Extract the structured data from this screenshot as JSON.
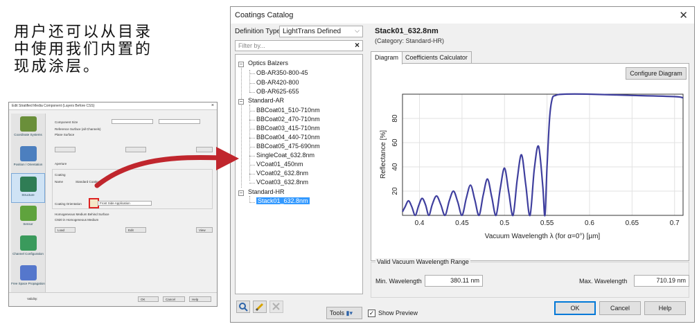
{
  "caption": {
    "line1": "用户还可以从目录",
    "line2": "中使用我们内置的",
    "line3": "现成涂层。"
  },
  "thumbnail": {
    "title": "Edit Stratified Media Component (Layers Before CSS)",
    "sidebar": [
      "Coordinate Systems",
      "Position / Orientation",
      "Structure",
      "Sensor",
      "Channel Configuration",
      "Free Space Propagation"
    ],
    "component_size_label": "Component Size",
    "reference_surface_label": "Reference Surface (all Channels)",
    "plane_surface_label": "Plane Surface",
    "aperture_label": "Aperture",
    "coating_label": "Coating",
    "name_label": "Name",
    "name_value": "Standard Coating",
    "coating_orientation_label": "Coating Orientation",
    "coating_orientation_value": "Front Side Application",
    "medium_label": "Homogeneous Medium Behind Surface",
    "medium_value": "C920 in Homogeneous Medium",
    "load_label": "Load",
    "edit_label": "Edit",
    "view_label": "View",
    "validity_label": "Validity:",
    "ok": "OK",
    "cancel": "Cancel",
    "help": "Help"
  },
  "dialog": {
    "title": "Coatings Catalog",
    "definition_type_label": "Definition Type",
    "definition_type_value": "LightTrans Defined",
    "filter_placeholder": "Filter by...",
    "tree": {
      "groups": [
        {
          "label": "Optics Balzers",
          "items": [
            "OB-AR350-800-45",
            "OB-AR420-800",
            "OB-AR625-655"
          ]
        },
        {
          "label": "Standard-AR",
          "items": [
            "BBCoat01_510-710nm",
            "BBCoat02_470-710nm",
            "BBCoat03_415-710nm",
            "BBCoat04_440-710nm",
            "BBCoat05_475-690nm",
            "SingleCoat_632.8nm",
            "VCoat01_450nm",
            "VCoat02_632.8nm",
            "VCoat03_632.8nm"
          ]
        },
        {
          "label": "Standard-HR",
          "items": [
            "Stack01_632.8nm"
          ]
        }
      ],
      "selected": "Stack01_632.8nm"
    },
    "tools_label": "Tools",
    "show_preview_label": "Show Preview",
    "selected_title": "Stack01_632.8nm",
    "selected_category": "(Category: Standard-HR)",
    "tabs": [
      "Diagram",
      "Coefficients Calculator"
    ],
    "configure_diagram_label": "Configure Diagram",
    "range_group_label": "Valid Vacuum Wavelength Range",
    "min_wavelength_label": "Min. Wavelength",
    "min_wavelength_value": "380.11 nm",
    "max_wavelength_label": "Max. Wavelength",
    "max_wavelength_value": "710.19 nm",
    "ok": "OK",
    "cancel": "Cancel",
    "help": "Help"
  },
  "chart_data": {
    "type": "line",
    "xlabel": "Vacuum Wavelength λ (for α=0°) [µm]",
    "ylabel": "Reflectance [%]",
    "xlim": [
      0.38,
      0.71
    ],
    "ylim": [
      0,
      100
    ],
    "xticks": [
      "0.4",
      "0.45",
      "0.5",
      "0.55",
      "0.6",
      "0.65",
      "0.7"
    ],
    "yticks": [
      "20",
      "40",
      "60",
      "80"
    ],
    "x": [
      0.38,
      0.383,
      0.387,
      0.391,
      0.395,
      0.399,
      0.403,
      0.407,
      0.411,
      0.415,
      0.42,
      0.425,
      0.43,
      0.435,
      0.44,
      0.445,
      0.45,
      0.455,
      0.46,
      0.465,
      0.47,
      0.475,
      0.48,
      0.485,
      0.49,
      0.495,
      0.5,
      0.505,
      0.51,
      0.515,
      0.52,
      0.525,
      0.53,
      0.535,
      0.54,
      0.545,
      0.5475,
      0.55,
      0.553,
      0.556,
      0.56,
      0.57,
      0.6,
      0.65,
      0.7,
      0.71
    ],
    "y": [
      3,
      7,
      12,
      7,
      0,
      8,
      14,
      9,
      0,
      9,
      16,
      9,
      0,
      12,
      20,
      11,
      0,
      14,
      25,
      13,
      0,
      17,
      30,
      15,
      0,
      22,
      39,
      19,
      0,
      30,
      50,
      25,
      0,
      38,
      57,
      24,
      0,
      40,
      80,
      96,
      99,
      100,
      100,
      99,
      98,
      97
    ],
    "grid": true
  },
  "colors": {
    "accent": "#3399ff",
    "curve": "#3f3f9e",
    "arrow": "#c0262d"
  },
  "icons": [
    "search-icon",
    "edit-icon",
    "delete-icon",
    "tools-icon",
    "close-icon"
  ]
}
